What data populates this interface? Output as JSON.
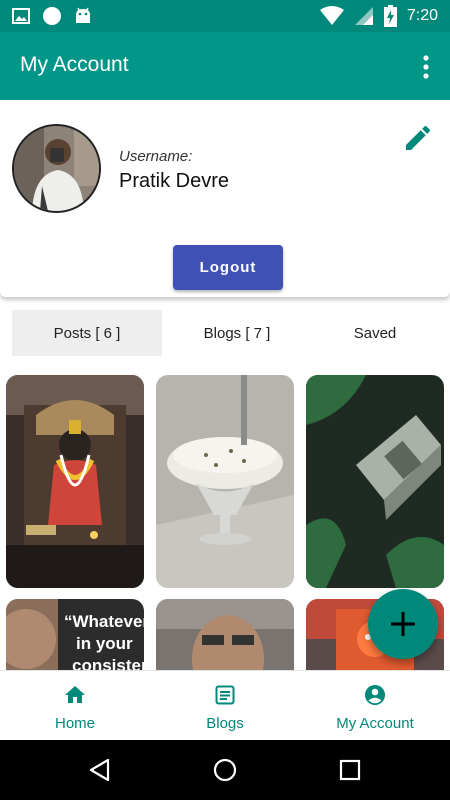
{
  "status_bar": {
    "time": "7:20",
    "left_icons": [
      "image-icon",
      "circle-icon",
      "android-icon"
    ],
    "right_icons": [
      "wifi-icon",
      "signal-icon",
      "battery-charging-icon"
    ]
  },
  "app_bar": {
    "title": "My Account",
    "menu_icon": "more-vert-icon"
  },
  "profile": {
    "username_label": "Username:",
    "username": "Pratik Devre",
    "edit_icon": "edit-icon",
    "logout_label": "Logout"
  },
  "tabs": [
    {
      "label": "Posts [ 6 ]",
      "active": true
    },
    {
      "label": "Blogs [ 7 ]",
      "active": false
    },
    {
      "label": "Saved",
      "active": false
    }
  ],
  "grid": {
    "tiles": [
      {
        "description": "shrine-photo"
      },
      {
        "description": "dessert-photo"
      },
      {
        "description": "stapler-photo"
      },
      {
        "description": "quote-photo",
        "text_lines": [
          "“Whatever",
          "in your",
          "consister"
        ]
      },
      {
        "description": "selfie-photo"
      },
      {
        "description": "idol-photo"
      }
    ]
  },
  "fab": {
    "icon": "plus-icon"
  },
  "bottom_nav": {
    "items": [
      {
        "label": "Home",
        "icon": "home-icon"
      },
      {
        "label": "Blogs",
        "icon": "article-icon"
      },
      {
        "label": "My Account",
        "icon": "account-circle-icon"
      }
    ]
  },
  "system_nav": [
    "back-icon",
    "home-circle-icon",
    "recents-icon"
  ],
  "colors": {
    "primary": "#009688",
    "primary_dark": "#00897b",
    "logout_button": "#3f51b5",
    "tab_active_bg": "#eeeeee"
  }
}
